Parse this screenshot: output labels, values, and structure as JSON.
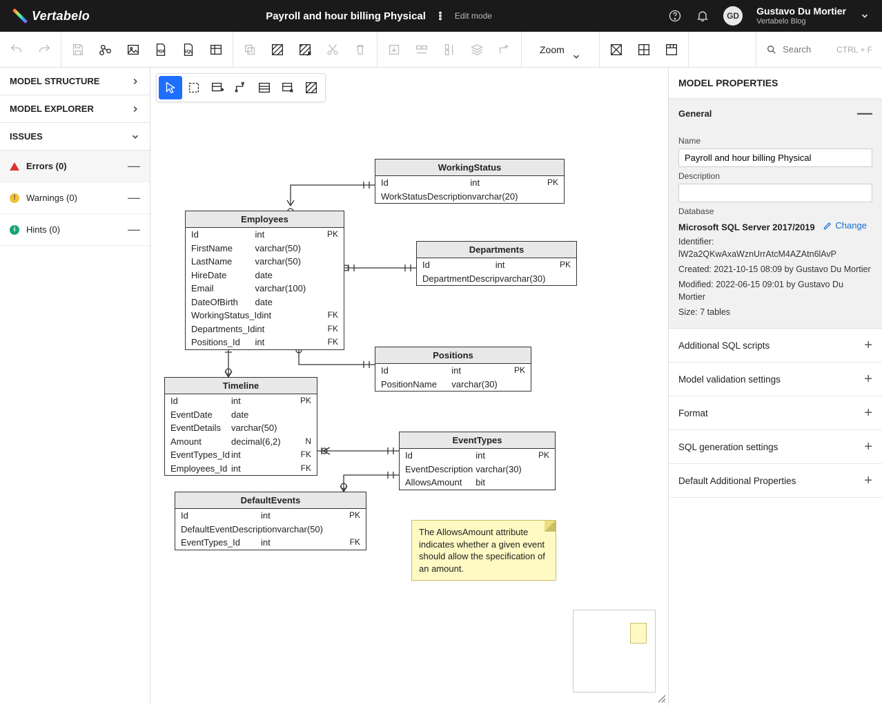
{
  "header": {
    "brand": "Vertabelo",
    "doc_title": "Payroll and hour billing Physical",
    "edit_mode": "Edit mode",
    "avatar": "GD",
    "user_name": "Gustavo Du Mortier",
    "user_sub": "Vertabelo Blog"
  },
  "toolbar": {
    "zoom_label": "Zoom",
    "search_placeholder": "Search",
    "search_hint": "CTRL + F"
  },
  "left_panel": {
    "model_structure": "MODEL STRUCTURE",
    "model_explorer": "MODEL EXPLORER",
    "issues": "ISSUES",
    "errors": "Errors (0)",
    "warnings": "Warnings (0)",
    "hints": "Hints (0)"
  },
  "right_panel": {
    "title": "MODEL PROPERTIES",
    "general": "General",
    "name_label": "Name",
    "name_value": "Payroll and hour billing Physical",
    "desc_label": "Description",
    "desc_value": "",
    "database_label": "Database",
    "database_value": "Microsoft SQL Server 2017/2019",
    "change": "Change",
    "identifier": "Identifier: lW2a2QKwAxaWznUrrAtcM4AZAtn6lAvP",
    "created": "Created: 2021-10-15 08:09 by Gustavo Du Mortier",
    "modified": "Modified: 2022-06-15 09:01 by Gustavo Du Mortier",
    "size": "Size: 7 tables",
    "additional_sql": "Additional SQL scripts",
    "validation": "Model validation settings",
    "format": "Format",
    "sql_gen": "SQL generation settings",
    "default_props": "Default Additional Properties"
  },
  "tables": {
    "employees": {
      "name": "Employees",
      "cols": [
        [
          "Id",
          "int",
          "PK"
        ],
        [
          "FirstName",
          "varchar(50)",
          ""
        ],
        [
          "LastName",
          "varchar(50)",
          ""
        ],
        [
          "HireDate",
          "date",
          ""
        ],
        [
          "Email",
          "varchar(100)",
          ""
        ],
        [
          "DateOfBirth",
          "date",
          ""
        ],
        [
          "WorkingStatus_Id",
          "int",
          "FK"
        ],
        [
          "Departments_Id",
          "int",
          "FK"
        ],
        [
          "Positions_Id",
          "int",
          "FK"
        ]
      ]
    },
    "workingstatus": {
      "name": "WorkingStatus",
      "cols": [
        [
          "Id",
          "int",
          "PK"
        ],
        [
          "WorkStatusDescription",
          "varchar(20)",
          ""
        ]
      ]
    },
    "departments": {
      "name": "Departments",
      "cols": [
        [
          "Id",
          "int",
          "PK"
        ],
        [
          "DepartmentDescrip",
          "varchar(30)",
          ""
        ]
      ]
    },
    "positions": {
      "name": "Positions",
      "cols": [
        [
          "Id",
          "int",
          "PK"
        ],
        [
          "PositionName",
          "varchar(30)",
          ""
        ]
      ]
    },
    "timeline": {
      "name": "Timeline",
      "cols": [
        [
          "Id",
          "int",
          "PK"
        ],
        [
          "EventDate",
          "date",
          ""
        ],
        [
          "EventDetails",
          "varchar(50)",
          ""
        ],
        [
          "Amount",
          "decimal(6,2)",
          "N"
        ],
        [
          "EventTypes_Id",
          "int",
          "FK"
        ],
        [
          "Employees_Id",
          "int",
          "FK"
        ]
      ]
    },
    "eventtypes": {
      "name": "EventTypes",
      "cols": [
        [
          "Id",
          "int",
          "PK"
        ],
        [
          "EventDescription",
          "varchar(30)",
          ""
        ],
        [
          "AllowsAmount",
          "bit",
          ""
        ]
      ]
    },
    "defaultevents": {
      "name": "DefaultEvents",
      "cols": [
        [
          "Id",
          "int",
          "PK"
        ],
        [
          "DefaultEventDescription",
          "varchar(50)",
          ""
        ],
        [
          "EventTypes_Id",
          "int",
          "FK"
        ]
      ]
    }
  },
  "note": "The AllowsAmount attribute indicates whether a given event should allow the specification of an amount."
}
